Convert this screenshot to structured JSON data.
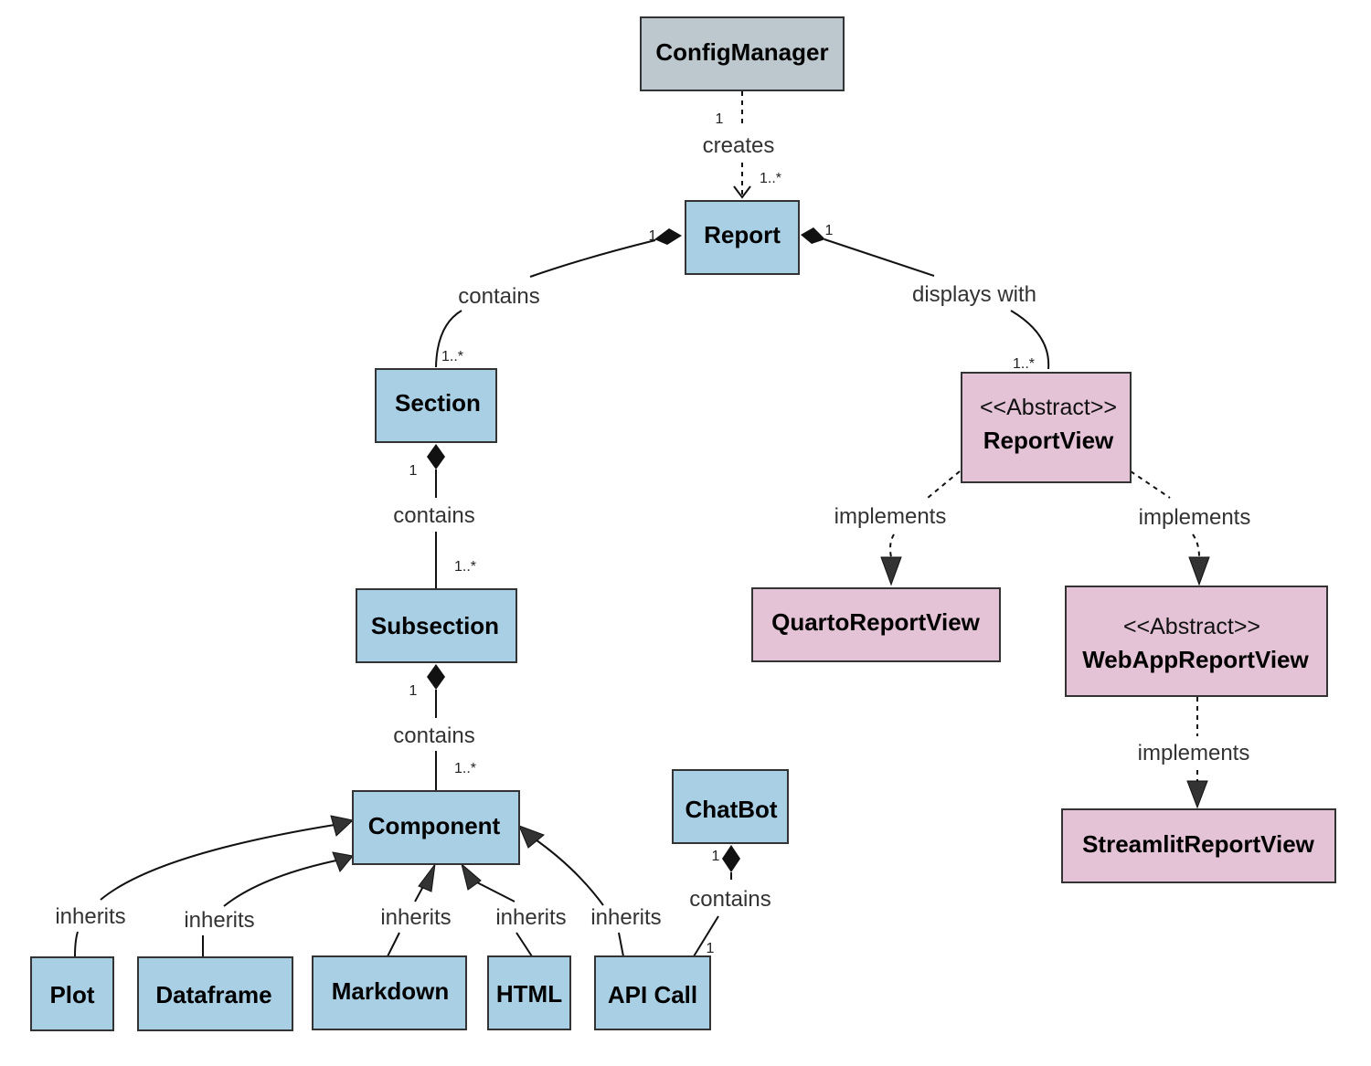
{
  "colors": {
    "class": "#a9cfe4",
    "manager": "#bcc7ce",
    "view": "#e4c3d7"
  },
  "nodes": {
    "configmanager": {
      "name": "ConfigManager"
    },
    "report": {
      "name": "Report"
    },
    "section": {
      "name": "Section"
    },
    "subsection": {
      "name": "Subsection"
    },
    "component": {
      "name": "Component"
    },
    "chatbot": {
      "name": "ChatBot"
    },
    "plot": {
      "name": "Plot"
    },
    "dataframe": {
      "name": "Dataframe"
    },
    "markdown": {
      "name": "Markdown"
    },
    "html": {
      "name": "HTML"
    },
    "apicall": {
      "name": "API Call"
    },
    "reportview": {
      "stereotype": "<<Abstract>>",
      "name": "ReportView"
    },
    "quarto": {
      "name": "QuartoReportView"
    },
    "webapp": {
      "stereotype": "<<Abstract>>",
      "name": "WebAppReportView"
    },
    "streamlit": {
      "name": "StreamlitReportView"
    }
  },
  "edges": {
    "creates": {
      "label": "creates",
      "from_mult": "1",
      "to_mult": "1..*"
    },
    "report_section": {
      "label": "contains",
      "from_mult": "1",
      "to_mult": "1..*"
    },
    "report_view": {
      "label": "displays with",
      "from_mult": "1",
      "to_mult": "1..*"
    },
    "section_subsection": {
      "label": "contains",
      "from_mult": "1",
      "to_mult": "1..*"
    },
    "subsection_component": {
      "label": "contains",
      "from_mult": "1",
      "to_mult": "1..*"
    },
    "chatbot_apicall": {
      "label": "contains",
      "from_mult": "1",
      "to_mult": "1"
    },
    "plot_inherits": {
      "label": "inherits"
    },
    "dataframe_inherits": {
      "label": "inherits"
    },
    "markdown_inherits": {
      "label": "inherits"
    },
    "html_inherits": {
      "label": "inherits"
    },
    "apicall_inherits": {
      "label": "inherits"
    },
    "quarto_implements": {
      "label": "implements"
    },
    "webapp_implements": {
      "label": "implements"
    },
    "streamlit_implements": {
      "label": "implements"
    }
  }
}
